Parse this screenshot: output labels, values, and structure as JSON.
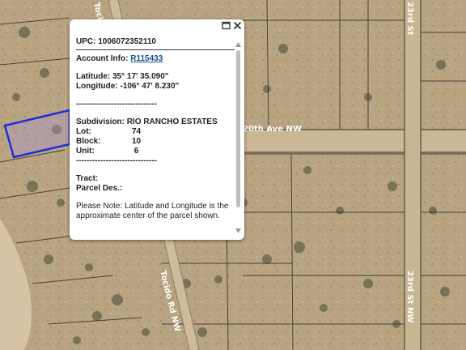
{
  "map": {
    "roads": [
      {
        "name": "20th Ave NW"
      },
      {
        "name": "Tocido Rd NW"
      },
      {
        "name": "Tocido Rd NW"
      },
      {
        "name": "23rd St"
      },
      {
        "name": "23rd St NW"
      }
    ],
    "parcel_highlight_color": "#1f2fd6"
  },
  "popup": {
    "upc_label": "UPC:",
    "upc_value": "1006072352110",
    "account_label": "Account Info:",
    "account_value": "R115433",
    "latitude_label": "Latitude:",
    "latitude_value": "35° 17' 35.090\"",
    "longitude_label": "Longitude:",
    "longitude_value": "-106° 47' 8.230\"",
    "separator": "------------------------------",
    "subdivision_label": "Subdivision:",
    "subdivision_value": "RIO RANCHO ESTATES",
    "lot_label": "Lot:",
    "lot_value": "74",
    "block_label": "Block:",
    "block_value": "10",
    "unit_label": "Unit:",
    "unit_value": " 6",
    "separator2": "------------------------------",
    "tract_label": "Tract:",
    "parcel_des_label": "Parcel Des.:",
    "note": "Please Note: Latitude and Longitude is the approximate center of the parcel shown.",
    "maximize_icon": "maximize-icon",
    "close_icon": "close-icon"
  }
}
